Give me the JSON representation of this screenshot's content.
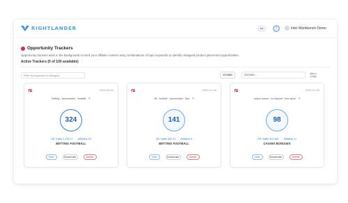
{
  "app": {
    "logo_text": "RIGHTLANDER",
    "language": "en",
    "username": "Intel Workbench Demo",
    "accent": "#2f7de1",
    "brand_color": "#4aa3df"
  },
  "page": {
    "title": "Opportunity Trackers",
    "description": "Opportunity trackers work in the background to track your affiliate content using combinations of topic keywords to identify untapped product placement opportunities.",
    "active_title": "Active Trackers (9 of 100 available)"
  },
  "toolbar": {
    "search_placeholder": "Filter by keyword or category",
    "create_label": "Create",
    "domain_placeholder": "Domain..."
  },
  "cards": [
    {
      "date": "2023-03-02",
      "keywords": "'betting', 'accumulator', 'football'",
      "count": "324",
      "stats_left": "GB Traffic 1,230.17",
      "stats_right": "Affiliates 18",
      "label": "BETTING FOOTBALL",
      "view": "View",
      "deactivate": "Deactivate",
      "delete": "Delete"
    },
    {
      "date": "2023-01-30",
      "keywords": "'nfl', 'football', 'accumulator', 'tips'",
      "count": "141",
      "stats_left": "GB Traffic 600.23",
      "stats_right": "Affiliates 5",
      "label": "BETTING FOOTBALL",
      "view": "View",
      "deactivate": "Deactivate",
      "delete": "Delete"
    },
    {
      "date": "2023-01-30",
      "keywords": "'casino bonus', 'no deposit', 'free spins'",
      "count": "98",
      "stats_left": "GB Traffic 523.480",
      "stats_right": "Affiliates 11",
      "label": "CASINO BONUSES",
      "view": "View",
      "deactivate": "Deactivate",
      "delete": "Delete"
    }
  ]
}
